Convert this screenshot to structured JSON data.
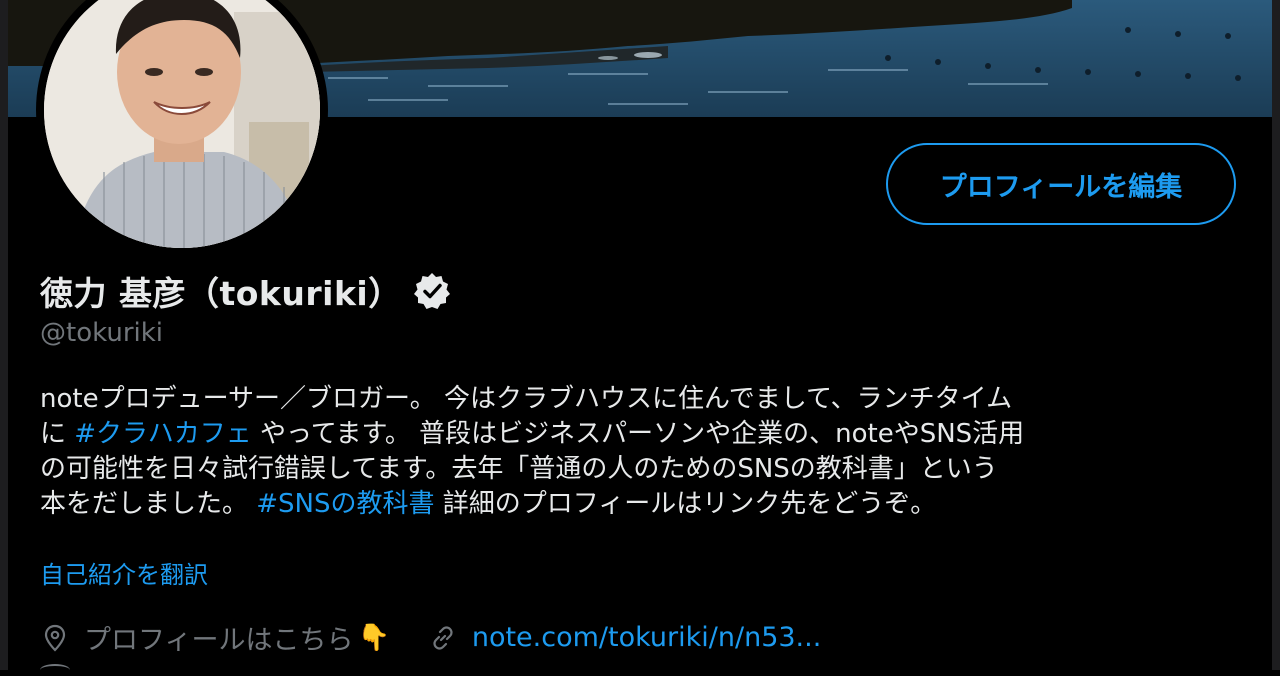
{
  "profile": {
    "display_name": "徳力 基彦（tokuriki）",
    "handle": "@tokuriki",
    "edit_button_label": "プロフィールを編集",
    "bio_lines": [
      [
        {
          "text": "noteプロデューサー／ブロガー。 今はクラブハウスに住んでまして、ランチタイム",
          "tag": false
        }
      ],
      [
        {
          "text": "に ",
          "tag": false
        },
        {
          "text": "#クラハカフェ",
          "tag": true
        },
        {
          "text": " やってます。 普段はビジネスパーソンや企業の、noteやSNS活用",
          "tag": false
        }
      ],
      [
        {
          "text": "の可能性を日々試行錯誤してます。去年「普通の人のためのSNSの教科書」という",
          "tag": false
        }
      ],
      [
        {
          "text": "本をだしました。 ",
          "tag": false
        },
        {
          "text": "#SNSの教科書",
          "tag": true
        },
        {
          "text": " 詳細のプロフィールはリンク先をどうぞ。",
          "tag": false
        }
      ]
    ],
    "translate_label": "自己紹介を翻訳",
    "location": "プロフィールはこちら",
    "location_emoji": "👇",
    "link": "note.com/tokuriki/n/n53..."
  },
  "colors": {
    "accent": "#1d9bf0",
    "text_primary": "#e7e9ea",
    "text_secondary": "#71767b",
    "background": "#000000"
  },
  "icons": {
    "verified": "verified-badge-icon",
    "location": "location-pin-icon",
    "link": "link-icon"
  }
}
